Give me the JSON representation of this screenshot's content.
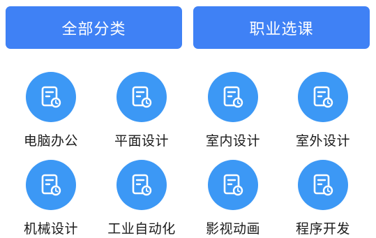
{
  "tabs": [
    {
      "label": "全部分类"
    },
    {
      "label": "职业选课"
    }
  ],
  "categories": [
    {
      "label": "电脑办公",
      "icon": "course-doc-icon"
    },
    {
      "label": "平面设计",
      "icon": "course-doc-icon"
    },
    {
      "label": "室内设计",
      "icon": "course-doc-icon"
    },
    {
      "label": "室外设计",
      "icon": "course-doc-icon"
    },
    {
      "label": "机械设计",
      "icon": "course-doc-icon"
    },
    {
      "label": "工业自动化",
      "icon": "course-doc-icon"
    },
    {
      "label": "影视动画",
      "icon": "course-doc-icon"
    },
    {
      "label": "程序开发",
      "icon": "course-doc-icon"
    }
  ],
  "colors": {
    "tab_bg": "#3f81f5",
    "icon_bg": "#3c98f5",
    "text": "#1a1a1a"
  }
}
